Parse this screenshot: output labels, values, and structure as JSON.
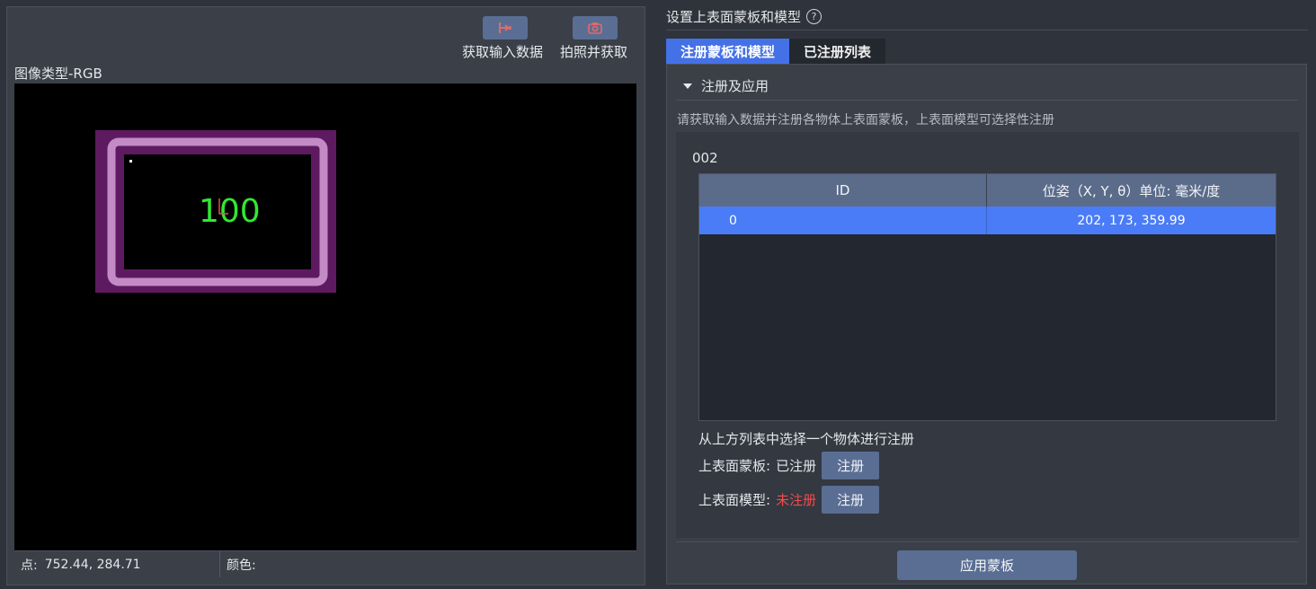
{
  "left": {
    "toolbar": {
      "get_input_label": "获取输入数据",
      "capture_label": "拍照并获取"
    },
    "image_type": "图像类型-RGB",
    "viewer": {
      "overlay_text": "100",
      "mask_color": "#5e1a60",
      "ring_color": "#c38ac6",
      "text_color": "#33e633"
    },
    "status": {
      "point_label": "点:",
      "point_value": "752.44, 284.71",
      "color_label": "颜色:",
      "color_value": ""
    }
  },
  "right": {
    "title": "设置上表面蒙板和模型",
    "help": "?",
    "tabs": [
      {
        "label": "注册蒙板和模型",
        "active": true
      },
      {
        "label": "已注册列表",
        "active": false
      }
    ],
    "section_title": "注册及应用",
    "hint": "请获取输入数据并注册各物体上表面蒙板，上表面模型可选择性注册",
    "group_name": "002",
    "table": {
      "columns": [
        "ID",
        "位姿（X, Y, θ）单位: 毫米/度"
      ],
      "rows": [
        {
          "id": "0",
          "pose": "202, 173, 359.99"
        }
      ]
    },
    "select_hint": "从上方列表中选择一个物体进行注册",
    "mask": {
      "label": "上表面蒙板:",
      "status": "已注册",
      "button": "注册"
    },
    "model": {
      "label": "上表面模型:",
      "status": "未注册",
      "button": "注册"
    },
    "apply_button": "应用蒙板"
  },
  "colors": {
    "accent": "#4471e6",
    "button": "#5a6e94",
    "error": "#f24c4c"
  }
}
